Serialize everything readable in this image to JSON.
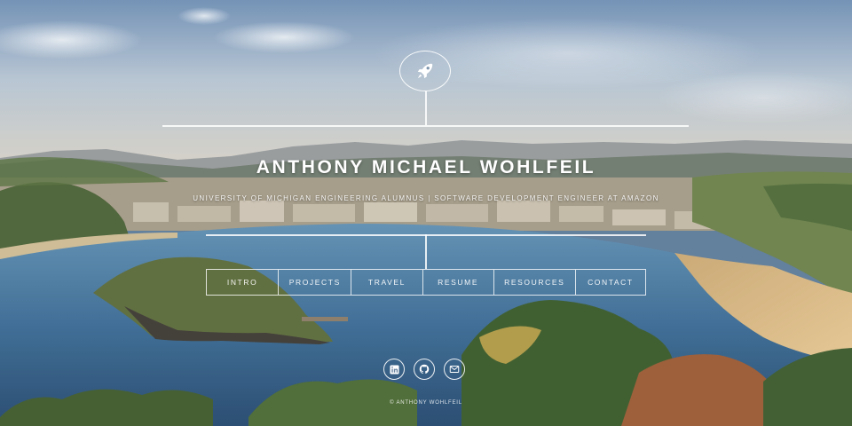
{
  "header": {
    "logo_icon": "rocket-icon",
    "title": "ANTHONY MICHAEL WOHLFEIL",
    "subtitle": "UNIVERSITY OF MICHIGAN ENGINEERING ALUMNUS | SOFTWARE DEVELOPMENT ENGINEER AT AMAZON"
  },
  "nav": {
    "items": [
      {
        "label": "INTRO"
      },
      {
        "label": "PROJECTS"
      },
      {
        "label": "TRAVEL"
      },
      {
        "label": "RESUME"
      },
      {
        "label": "RESOURCES"
      },
      {
        "label": "CONTACT"
      }
    ]
  },
  "socials": [
    {
      "icon": "linkedin-icon"
    },
    {
      "icon": "github-icon"
    },
    {
      "icon": "mail-icon"
    }
  ],
  "footer": {
    "text": "© ANTHONY WOHLFEIL"
  },
  "colors": {
    "text": "#ffffff",
    "sky": "#8aa7c4",
    "sea": "#2f5f86",
    "sand": "#d9b67e"
  }
}
